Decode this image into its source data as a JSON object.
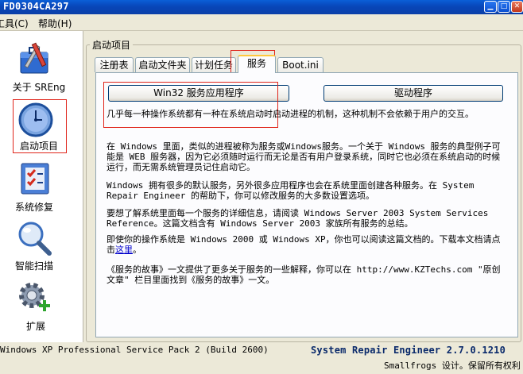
{
  "window": {
    "title": "FD0304CA297"
  },
  "menu": {
    "tools": "工具(C)",
    "help": "帮助(H)"
  },
  "sidebar": {
    "items": [
      {
        "label": "关于 SREng",
        "icon": "toolbox-icon"
      },
      {
        "label": "启动项目",
        "icon": "clock-icon"
      },
      {
        "label": "系统修复",
        "icon": "checklist-icon"
      },
      {
        "label": "智能扫描",
        "icon": "magnifier-icon"
      },
      {
        "label": "扩展",
        "icon": "gear-plus-icon"
      }
    ]
  },
  "group": {
    "title": "启动项目"
  },
  "tabs": [
    "注册表",
    "启动文件夹",
    "计划任务",
    "服务",
    "Boot.ini"
  ],
  "active_tab": "服务",
  "buttons": {
    "win32": "Win32 服务应用程序",
    "drivers": "驱动程序"
  },
  "content": {
    "p1": "几乎每一种操作系统都有一种在系统启动时启动进程的机制，这种机制不会依赖于用户的交互。",
    "p2": "在 Windows 里面，类似的进程被称为服务或Windows服务。一个关于 Windows 服务的典型例子可能是 WEB 服务器，因为它必须随时运行而无论是否有用户登录系统，同时它也必须在系统启动的时候运行，而无需系统管理员记住启动它。",
    "p3": "Windows 拥有很多的默认服务，另外很多应用程序也会在系统里面创建各种服务。在 System Repair Engineer 的帮助下，你可以修改服务的大多数设置选项。",
    "p4": "要想了解系统里面每一个服务的详细信息，请阅读 Windows Server 2003 System Services Reference。这篇文档含有 Windows Server 2003 家族所有服务的总结。",
    "p5_text": "即使你的操作系统是 Windows 2000 或 Windows XP，你也可以阅读这篇文档的。下载本文档请点击",
    "p5_link": "这里",
    "p5_end": "。",
    "p6": "《服务的故事》一文提供了更多关于服务的一些解释，你可以在 http://www.KZTechs.com \"原创文章\" 栏目里面找到《服务的故事》一文。"
  },
  "status": {
    "os": "Windows XP Professional Service Pack 2 (Build 2600)",
    "product": "System Repair Engineer 2.7.0.1210",
    "copyright": "Smallfrogs 设计。保留所有权利"
  }
}
